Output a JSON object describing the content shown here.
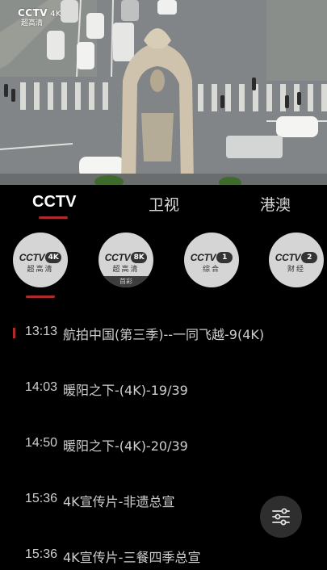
{
  "player": {
    "watermark": {
      "brand": "CCTV",
      "badge": "4K",
      "subtitle": "超高清"
    },
    "scene": "aerial-city-intersection-with-monument"
  },
  "tabs": [
    {
      "label": "CCTV",
      "active": true
    },
    {
      "label": "卫视",
      "active": false
    },
    {
      "label": "港澳",
      "active": false
    }
  ],
  "channels": [
    {
      "logo": "CCTV",
      "badge": "4K",
      "name": "超高清",
      "tag": "",
      "selected": true
    },
    {
      "logo": "CCTV",
      "badge": "8K",
      "name": "超高清",
      "tag": "首彩",
      "selected": false
    },
    {
      "logo": "CCTV",
      "badge": "1",
      "name": "综合",
      "tag": "",
      "selected": false
    },
    {
      "logo": "CCTV",
      "badge": "2",
      "name": "财经",
      "tag": "",
      "selected": false
    }
  ],
  "schedule": [
    {
      "time": "13:13",
      "title": "航拍中国(第三季)--一同飞越-9(4K)",
      "current": true
    },
    {
      "time": "14:03",
      "title": "暖阳之下-(4K)-19/39",
      "current": false
    },
    {
      "time": "14:50",
      "title": "暖阳之下-(4K)-20/39",
      "current": false
    },
    {
      "time": "15:36",
      "title": "4K宣传片-非遗总宣",
      "current": false
    },
    {
      "time": "15:36",
      "title": "4K宣传片-三餐四季总宣",
      "current": false
    }
  ],
  "controls": {
    "filter_icon": "sliders-icon"
  },
  "colors": {
    "accent": "#b02a2a",
    "background": "#000000",
    "text": "#cfcfcf"
  }
}
